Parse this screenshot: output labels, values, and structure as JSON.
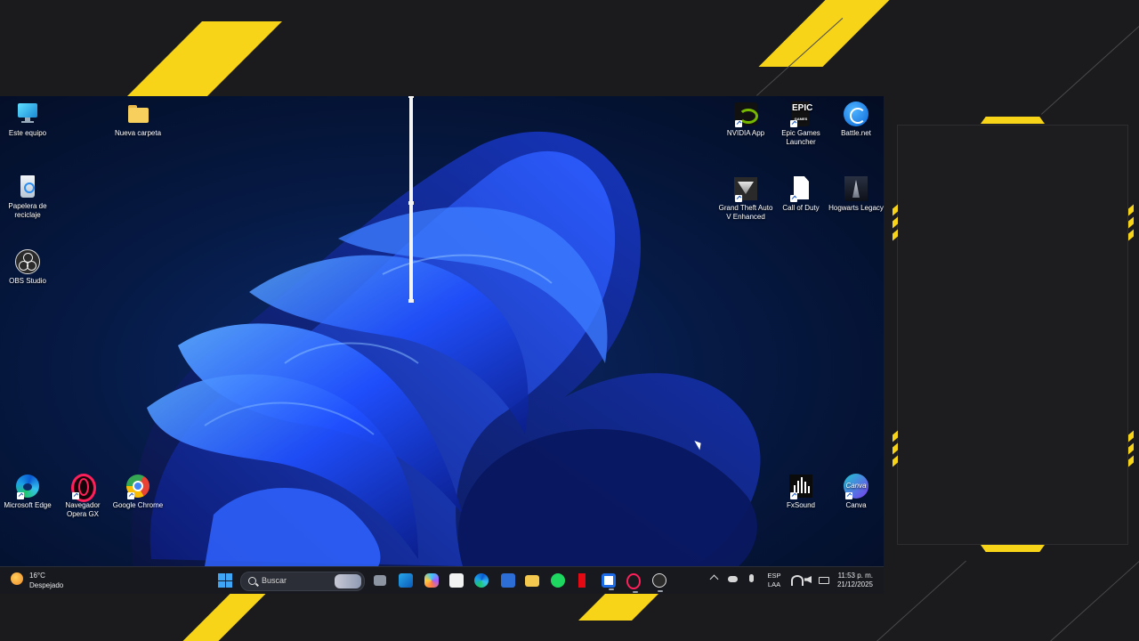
{
  "desktop_icons": [
    {
      "label": "Este equipo",
      "icon": "monitor-icon"
    },
    {
      "label": "Nueva carpeta",
      "icon": "folder-icon"
    },
    {
      "label": "Papelera de reciclaje",
      "icon": "recycle-bin-icon"
    },
    {
      "label": "OBS Studio",
      "icon": "obs-icon"
    },
    {
      "label": "Microsoft Edge",
      "icon": "edge-icon"
    },
    {
      "label": "Navegador Opera GX",
      "icon": "opera-gx-icon"
    },
    {
      "label": "Google Chrome",
      "icon": "chrome-icon"
    },
    {
      "label": "NVIDIA App",
      "icon": "nvidia-icon"
    },
    {
      "label": "Epic Games Launcher",
      "icon": "epic-games-icon"
    },
    {
      "label": "Battle.net",
      "icon": "battlenet-icon"
    },
    {
      "label": "Grand Theft Auto V Enhanced",
      "icon": "gta-icon"
    },
    {
      "label": "Call of Duty",
      "icon": "document-icon"
    },
    {
      "label": "Hogwarts Legacy",
      "icon": "hogwarts-icon"
    },
    {
      "label": "FxSound",
      "icon": "fxsound-icon"
    },
    {
      "label": "Canva",
      "icon": "canva-icon"
    }
  ],
  "epic_logo_text": "EPIC",
  "epic_logo_sub": "GAMES",
  "canva_logo_text": "Canva",
  "taskbar": {
    "weather": {
      "temp": "16°C",
      "condition": "Despejado"
    },
    "search_placeholder": "Buscar",
    "apps": [
      "windows-start-icon",
      "task-view-icon",
      "outlook-icon",
      "copilot-icon",
      "store-icon",
      "edge-icon",
      "todo-icon",
      "file-explorer-icon",
      "spotify-icon",
      "netflix-icon",
      "roblox-studio-icon",
      "opera-gx-icon",
      "obs-icon"
    ],
    "lang_top": "ESP",
    "lang_bottom": "LAA",
    "time": "11:53 p. m.",
    "date": "21/12/2025"
  },
  "colors": {
    "accent_yellow": "#f7d417",
    "taskbar_bg": "#17191f",
    "wallpaper_blue": "#1f4fff"
  }
}
